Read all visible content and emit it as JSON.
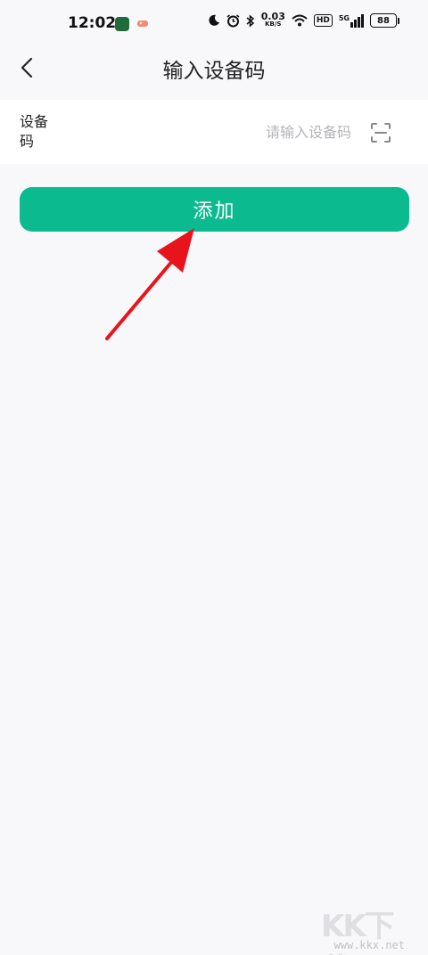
{
  "status_bar": {
    "time": "12:02",
    "network_speed_value": "0.03",
    "network_speed_unit": "KB/S",
    "hd_label": "HD",
    "signal_label": "5G",
    "battery_level": "88"
  },
  "nav": {
    "title": "输入设备码"
  },
  "device_code": {
    "label": "设备码",
    "value": "",
    "placeholder": "请输入设备码"
  },
  "actions": {
    "add_label": "添加"
  },
  "watermark": {
    "main": "KK下载",
    "url": "www.kkx.net"
  },
  "colors": {
    "accent": "#0bbb8f",
    "background": "#f8f7fa",
    "annotation": "#e8141c"
  }
}
